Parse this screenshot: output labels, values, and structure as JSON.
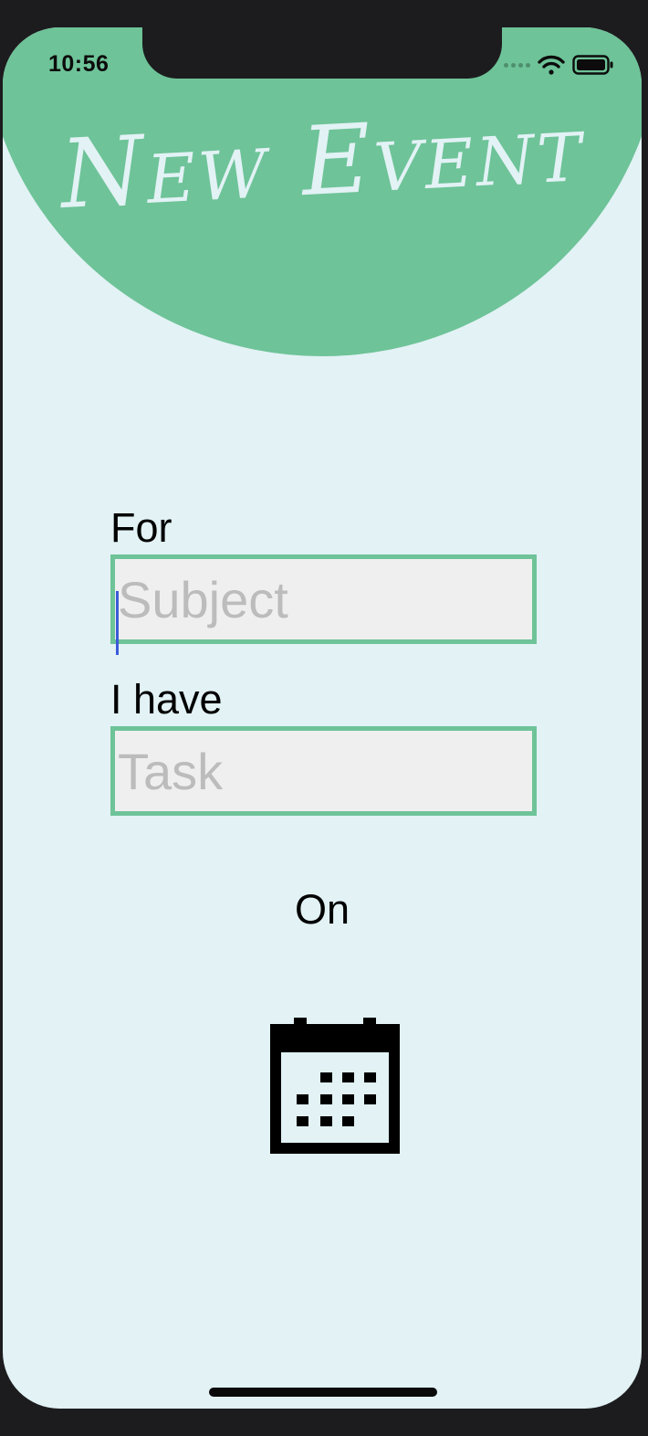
{
  "status_bar": {
    "time": "10:56",
    "icons": [
      "signal-dots-icon",
      "wifi-icon",
      "battery-icon"
    ]
  },
  "header": {
    "title": "New Event"
  },
  "form": {
    "subject_label": "For",
    "subject_placeholder": "Subject",
    "subject_value": "",
    "task_label": "I have",
    "task_placeholder": "Task",
    "task_value": "",
    "date_label": "On",
    "date_icon": "calendar-icon"
  },
  "colors": {
    "accent": "#6ec398",
    "background": "#e2f2f5",
    "input_fill": "#efefef",
    "placeholder": "#bcbcbc",
    "caret": "#3a5bd9"
  }
}
